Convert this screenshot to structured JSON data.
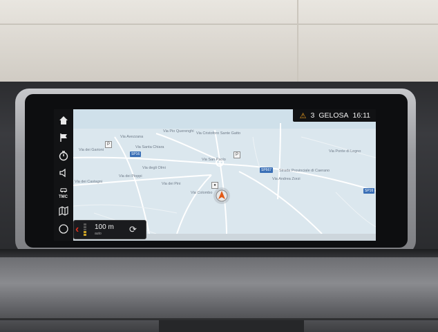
{
  "status": {
    "alert_count": "3",
    "street": "GELOSA",
    "time": "16:11"
  },
  "sidebar": {
    "items": [
      {
        "icon": "home-icon"
      },
      {
        "icon": "destination-flag-icon"
      },
      {
        "icon": "timer-icon"
      },
      {
        "icon": "voice-volume-icon"
      },
      {
        "icon": "tmc-traffic-icon",
        "label": "TMC"
      },
      {
        "icon": "map-icon"
      },
      {
        "icon": "compass-icon"
      }
    ]
  },
  "map": {
    "labels": [
      "Via Avezzana",
      "Via Pio Querenghi",
      "Via Cristoforo Sante Gatto",
      "Via dei Garioni",
      "Via Santa Chiara",
      "Via San Paolo",
      "Via Ponte di Legno",
      "Strada Provinciale di Caerano",
      "Via Andrea Zorzi",
      "Via dei Castagni",
      "Via dei Pioppi",
      "Via degli Olmi",
      "Via dei Pini",
      "Via Colombo"
    ],
    "shields": [
      "SP16",
      "SP667",
      "SP16"
    ]
  },
  "scale": {
    "value": "100 m",
    "sub": "auto"
  }
}
